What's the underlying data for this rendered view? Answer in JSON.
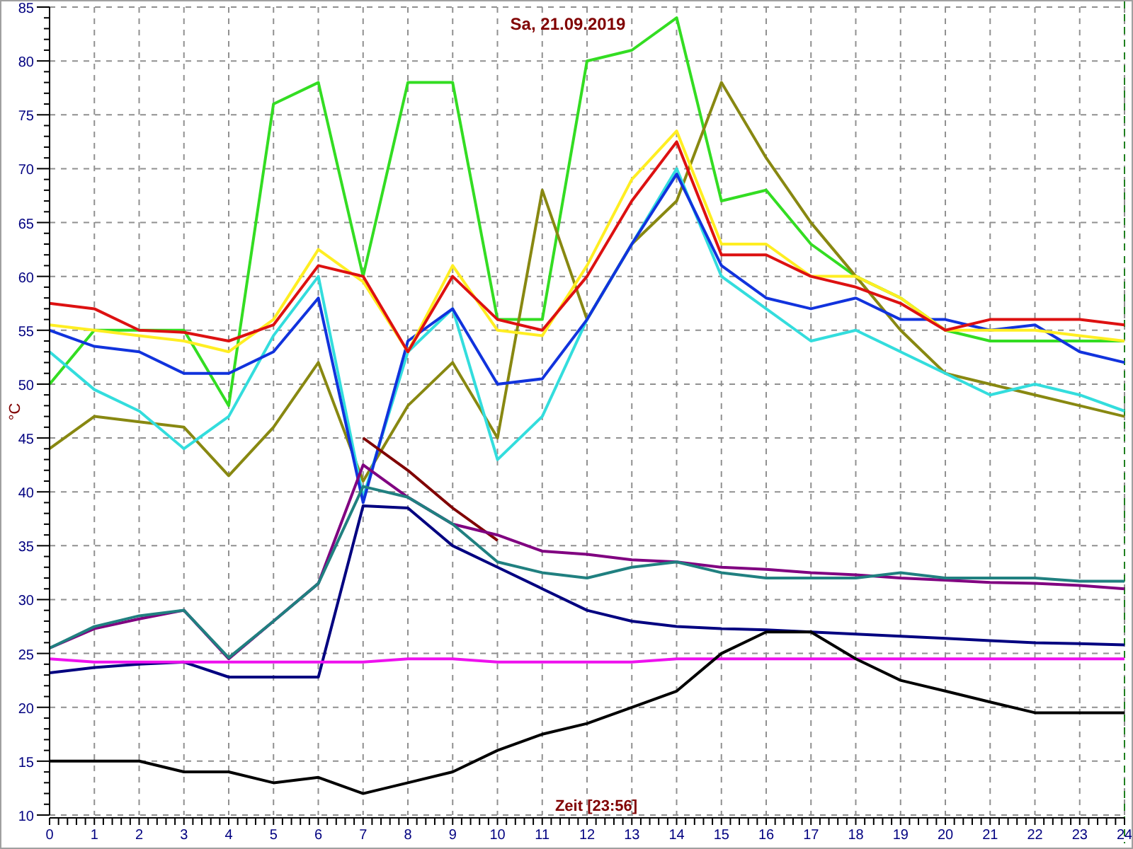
{
  "chart": {
    "chart_data": {
      "type": "line",
      "title": "Sa, 21.09.2019",
      "xlabel": "Zeit [23:56]",
      "ylabel": "°C",
      "x": [
        0,
        1,
        2,
        3,
        4,
        5,
        6,
        7,
        8,
        9,
        10,
        11,
        12,
        13,
        14,
        15,
        16,
        17,
        18,
        19,
        20,
        21,
        22,
        23,
        24
      ],
      "grid": true,
      "xlim": [
        0,
        24
      ],
      "ylim": [
        10,
        85
      ],
      "xticks": [
        0,
        1,
        2,
        3,
        4,
        5,
        6,
        7,
        8,
        9,
        10,
        11,
        12,
        13,
        14,
        15,
        16,
        17,
        18,
        19,
        20,
        21,
        22,
        23,
        24
      ],
      "yticks": [
        10,
        15,
        20,
        25,
        30,
        35,
        40,
        45,
        50,
        55,
        60,
        65,
        70,
        75,
        80,
        85
      ],
      "series": [
        {
          "color": "#33dd22",
          "values": [
            50,
            55,
            55,
            55,
            48,
            76,
            78,
            60,
            78,
            78,
            56,
            56,
            80,
            81,
            84,
            67,
            68,
            63,
            60,
            58,
            55,
            54,
            54,
            54,
            54
          ]
        },
        {
          "color": "#888811",
          "values": [
            44,
            47,
            46.5,
            46,
            41.5,
            46,
            52,
            41,
            48,
            52,
            45,
            68,
            56,
            63,
            67,
            78,
            71,
            65,
            60,
            55,
            51,
            50,
            49,
            48,
            47
          ]
        },
        {
          "color": "#33dddd",
          "values": [
            53,
            49.5,
            47.5,
            44,
            47,
            54.5,
            60,
            39.5,
            53,
            57,
            43,
            47,
            56,
            63,
            70,
            60,
            57,
            54,
            55,
            53,
            51,
            49,
            50,
            49,
            47.5
          ]
        },
        {
          "color": "#1133dd",
          "values": [
            55,
            53.5,
            53,
            51,
            51,
            53,
            58,
            39,
            54,
            57,
            50,
            50.5,
            56,
            63,
            69.5,
            61,
            58,
            57,
            58,
            56,
            56,
            55,
            55.5,
            53,
            52
          ]
        },
        {
          "color": "#ffee22",
          "values": [
            55.5,
            55,
            54.5,
            54,
            53,
            56,
            62.5,
            59.5,
            53,
            61,
            55,
            54.5,
            61,
            69,
            73.5,
            63,
            63,
            60,
            60,
            58,
            55,
            55,
            55,
            54.5,
            54
          ]
        },
        {
          "color": "#dd1111",
          "values": [
            57.5,
            57,
            55,
            54.8,
            54,
            55.5,
            61,
            60,
            53,
            60,
            56,
            55,
            60,
            67,
            72.5,
            62,
            62,
            60,
            59,
            57.5,
            55,
            56,
            56,
            56,
            55.5
          ]
        },
        {
          "color": "#800000",
          "values": [
            null,
            null,
            null,
            null,
            null,
            null,
            null,
            45,
            42,
            38.5,
            35.5,
            null,
            null,
            null,
            null,
            null,
            null,
            null,
            null,
            null,
            null,
            null,
            null,
            null,
            null
          ]
        },
        {
          "color": "#800080",
          "values": [
            25.5,
            27.3,
            28.2,
            29,
            24.5,
            28,
            31.5,
            42.5,
            39.5,
            37,
            36,
            34.5,
            34.2,
            33.7,
            33.5,
            33,
            32.8,
            32.5,
            32.3,
            32,
            31.8,
            31.6,
            31.5,
            31.3,
            31
          ]
        },
        {
          "color": "#208080",
          "values": [
            25.5,
            27.5,
            28.5,
            29,
            24.6,
            28,
            31.5,
            40.5,
            39.5,
            37,
            33.5,
            32.5,
            32,
            33,
            33.5,
            32.5,
            32,
            32,
            32,
            32.5,
            32,
            32,
            32,
            31.7,
            31.7
          ]
        },
        {
          "color": "#000080",
          "values": [
            23.2,
            23.7,
            24,
            24.2,
            22.8,
            22.8,
            22.8,
            38.7,
            38.5,
            35,
            33,
            31,
            29,
            28,
            27.5,
            27.3,
            27.2,
            27,
            26.8,
            26.6,
            26.4,
            26.2,
            26,
            25.9,
            25.8
          ]
        },
        {
          "color": "#ee11ee",
          "values": [
            24.5,
            24.2,
            24.2,
            24.2,
            24.2,
            24.2,
            24.2,
            24.2,
            24.5,
            24.5,
            24.2,
            24.2,
            24.2,
            24.2,
            24.5,
            24.5,
            24.5,
            24.5,
            24.5,
            24.5,
            24.5,
            24.5,
            24.5,
            24.5,
            24.5
          ]
        },
        {
          "color": "#000000",
          "values": [
            15,
            15,
            15,
            14,
            14,
            13,
            13.5,
            12,
            13,
            14,
            16,
            17.5,
            18.5,
            20,
            21.5,
            25,
            27,
            27,
            24.5,
            22.5,
            21.5,
            20.5,
            19.5,
            19.5,
            19.5
          ]
        }
      ]
    }
  }
}
